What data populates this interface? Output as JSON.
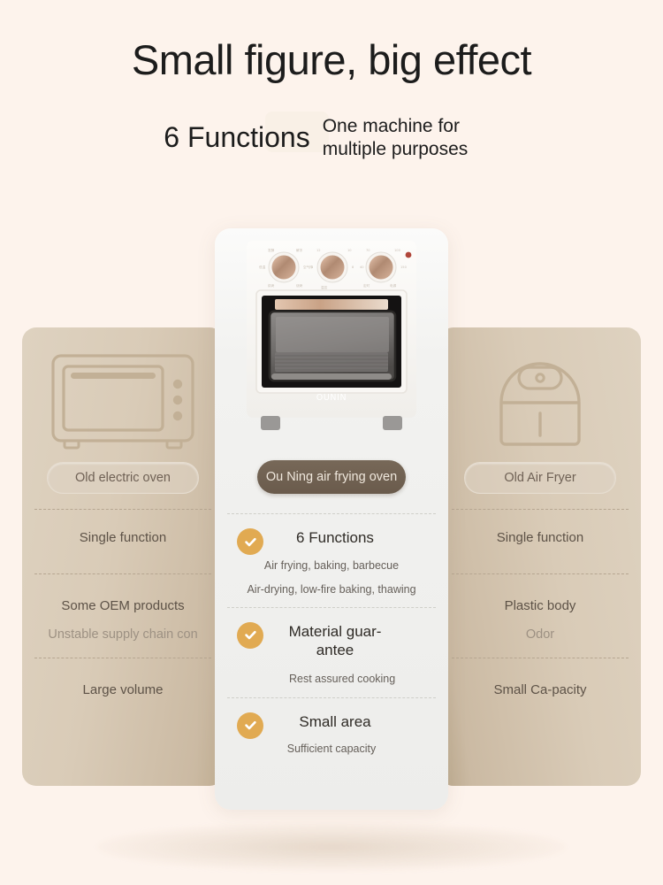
{
  "header": {
    "title": "Small figure, big effect",
    "subtitle_big": "6 Functions",
    "subtitle_small": "One machine for multiple purposes"
  },
  "colors": {
    "page_background": "#FDF3EC",
    "side_card": "#D9CBB7",
    "center_card": "#F2F2F0",
    "center_badge": "#6A5B4C",
    "check_icon": "#E1AA52",
    "accent_gold": "#C9A36A"
  },
  "columns": {
    "left": {
      "icon": "electric-oven-icon",
      "badge": "Old electric oven",
      "rows": [
        {
          "primary": "Single function",
          "secondary": ""
        },
        {
          "primary": "Some OEM products",
          "secondary": "Unstable supply chain con"
        },
        {
          "primary": "Large volume",
          "secondary": ""
        }
      ]
    },
    "center": {
      "icon": "air-frying-oven-photo",
      "brand": "OUNIN",
      "badge": "Ou Ning air frying oven",
      "features": [
        {
          "title": "6 Functions",
          "sub1": "Air frying, baking, barbecue",
          "sub2": "Air-drying, low-fire baking, thawing"
        },
        {
          "title": "Material guar-antee",
          "sub1": "Rest assured cooking",
          "sub2": ""
        },
        {
          "title": "Small area",
          "sub1": "Sufficient capacity",
          "sub2": ""
        }
      ]
    },
    "right": {
      "icon": "air-fryer-icon",
      "badge": "Old Air Fryer",
      "rows": [
        {
          "primary": "Single function",
          "secondary": ""
        },
        {
          "primary": "Plastic body",
          "secondary": "Odor"
        },
        {
          "primary": "Small Ca-pacity",
          "secondary": ""
        }
      ]
    }
  }
}
